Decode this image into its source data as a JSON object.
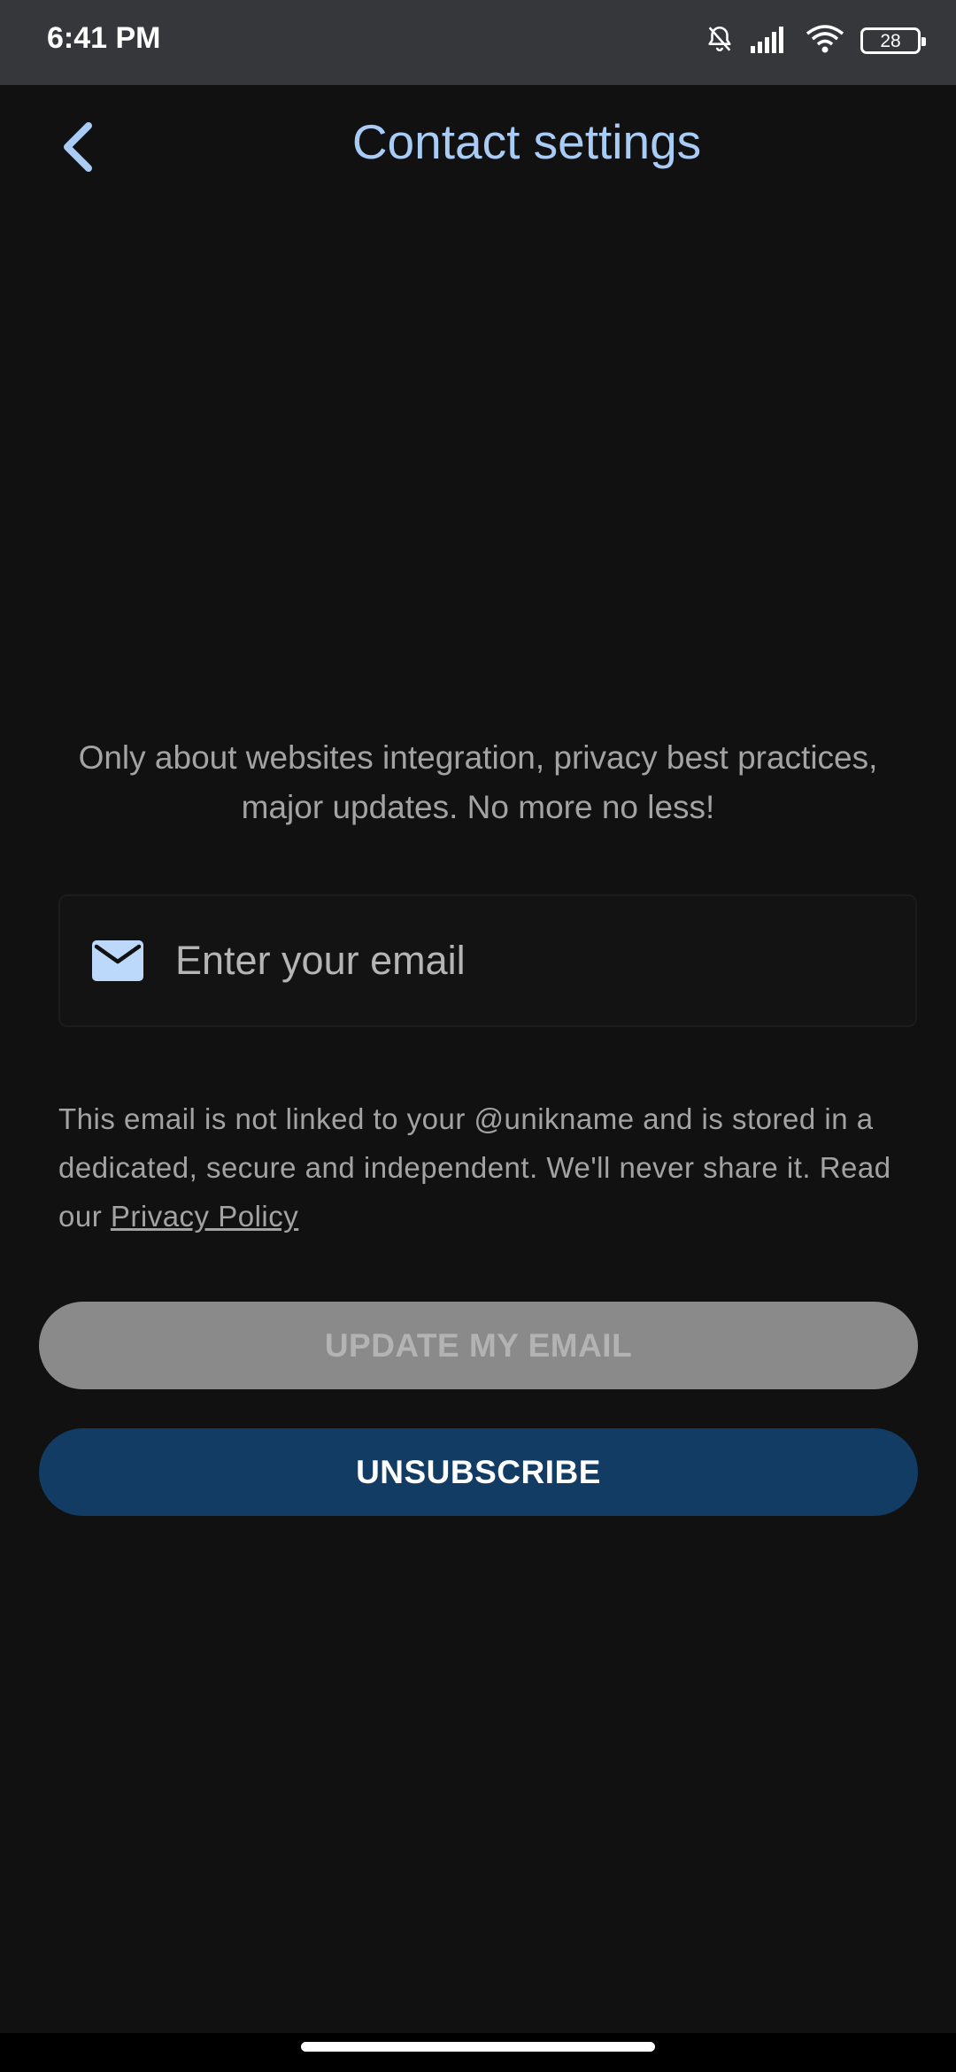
{
  "status_bar": {
    "time": "6:41 PM",
    "battery_level": "28",
    "icons": [
      "bell-off-icon",
      "signal-icon",
      "wifi-icon",
      "battery-icon"
    ]
  },
  "header": {
    "title": "Contact settings",
    "back_icon": "chevron-left-icon"
  },
  "content": {
    "description": "Only about websites integration, privacy best practices, major updates. No more no less!",
    "email_field": {
      "placeholder": "Enter your email",
      "value": "",
      "icon": "mail-icon"
    },
    "notice": {
      "text": "This email is not linked to your @unikname and is stored in a dedicated, secure and independent. We'll never share it. Read our ",
      "link_label": "Privacy Policy"
    }
  },
  "buttons": {
    "update_label": "UPDATE MY EMAIL",
    "unsubscribe_label": "UNSUBSCRIBE"
  },
  "colors": {
    "background": "#111111",
    "status_bar": "#36373b",
    "accent": "#a9ccf7",
    "primary_button": "#123c63",
    "disabled_button": "#8a8a8a"
  }
}
